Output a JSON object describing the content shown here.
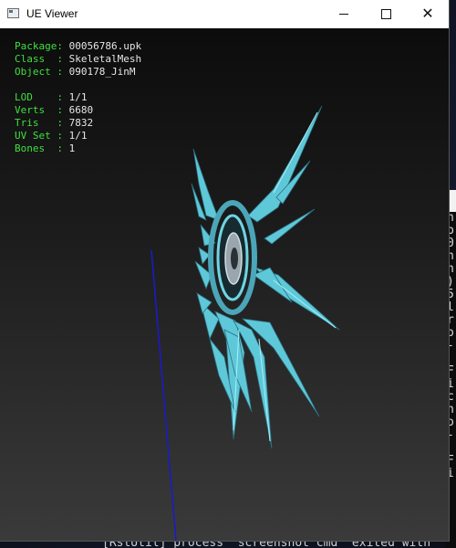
{
  "window": {
    "title": "UE Viewer",
    "controls": {
      "minimize": "",
      "maximize": "",
      "close": "✕"
    }
  },
  "info": {
    "package_key": "Package",
    "package_val": "00056786.upk",
    "class_key": "Class  ",
    "class_val": "SkeletalMesh",
    "object_key": "Object ",
    "object_val": "090178_JinM",
    "lod_key": "LOD    ",
    "lod_val": "1/1",
    "verts_key": "Verts  ",
    "verts_val": "6680",
    "tris_key": "Tris   ",
    "tris_val": "7832",
    "uvset_key": "UV Set ",
    "uvset_val": "1/1",
    "bones_key": "Bones  ",
    "bones_val": "1"
  },
  "background": {
    "left_char": "M",
    "console_chars": [
      "n",
      "p",
      "0",
      "n",
      "n",
      ")",
      "5",
      "l",
      "r",
      "o",
      "-",
      "",
      "F",
      "i",
      "c",
      "h",
      "o",
      "-",
      "",
      "F",
      "i"
    ],
    "status_line": "[RstUtil] process \"screenshot_cmd\" exited with"
  },
  "colors": {
    "mesh": "#5ec8d8",
    "mesh_dark": "#2b6f80",
    "axis": "#1a1ad0",
    "info_key": "#3ee03e"
  }
}
